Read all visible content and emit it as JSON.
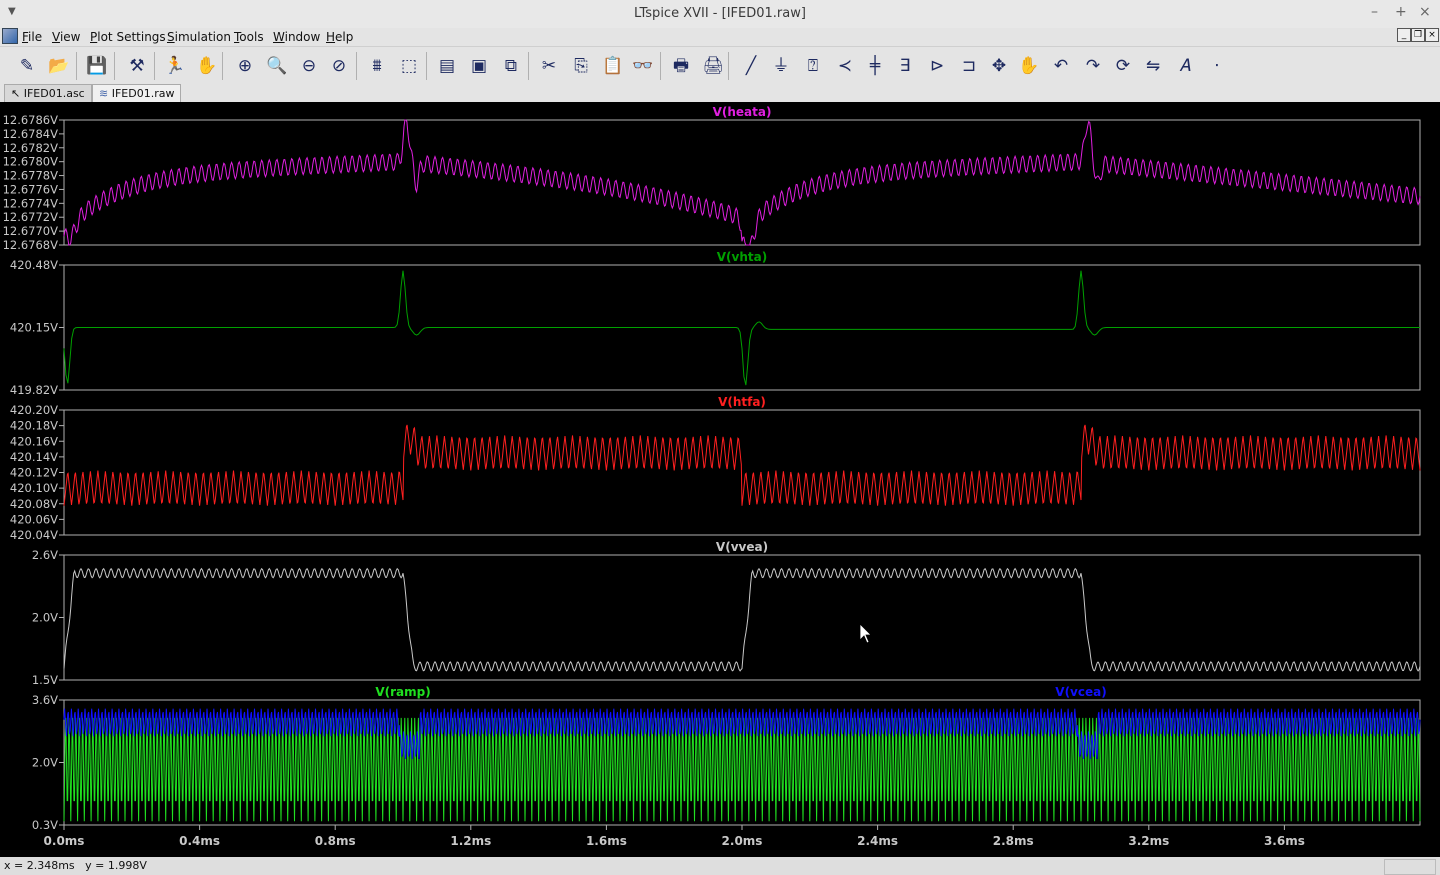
{
  "window": {
    "title": "LTspice XVII - [IFED01.raw]",
    "controls": [
      "–",
      "+",
      "×"
    ]
  },
  "menu": [
    "File",
    "View",
    "Plot Settings",
    "Simulation",
    "Tools",
    "Window",
    "Help"
  ],
  "toolbar_icons": [
    "new-schematic-icon",
    "open-icon",
    "save-icon",
    "control-panel-icon",
    "run-icon",
    "halt-icon",
    "zoom-in-icon",
    "zoom-out-icon",
    "zoom-full-icon",
    "zoom-cancel-icon",
    "autorange-icon",
    "select-plane-icon",
    "tile-horizontal-icon",
    "cascade-icon",
    "tile-vertical-icon",
    "cut-icon",
    "copy-icon",
    "paste-icon",
    "find-icon",
    "print-preview-icon",
    "print-icon",
    "draw-wire-icon",
    "ground-icon",
    "label-net-icon",
    "resistor-icon",
    "capacitor-icon",
    "inductor-icon",
    "diode-icon",
    "component-icon",
    "move-icon",
    "drag-icon",
    "undo-icon",
    "redo-icon",
    "rotate-icon",
    "mirror-icon",
    "text-icon",
    "spice-directive-icon"
  ],
  "tabs": [
    {
      "label": "IFED01.asc",
      "active": false
    },
    {
      "label": "IFED01.raw",
      "active": true
    }
  ],
  "status": {
    "x": "x = 2.348ms",
    "y": "y = 1.998V"
  },
  "colors": {
    "heata": "#e020e0",
    "vhta": "#00a000",
    "htfa": "#ff2020",
    "vvea": "#c8c8c8",
    "ramp": "#20e020",
    "vcea": "#1010ff"
  },
  "chart_data": [
    {
      "type": "line",
      "title": "V(heata)",
      "series": [
        {
          "name": "V(heata)",
          "color": "#e020e0"
        }
      ],
      "xlim": [
        0,
        4.0
      ],
      "ylim": [
        12.6768,
        12.6786
      ],
      "yticks": [
        "12.6786V",
        "12.6784V",
        "12.6782V",
        "12.6780V",
        "12.6778V",
        "12.6776V",
        "12.6774V",
        "12.6772V",
        "12.6770V",
        "12.6768V"
      ],
      "xticks": []
    },
    {
      "type": "line",
      "title": "V(vhta)",
      "series": [
        {
          "name": "V(vhta)",
          "color": "#00a000"
        }
      ],
      "xlim": [
        0,
        4.0
      ],
      "ylim": [
        419.82,
        420.48
      ],
      "yticks": [
        "420.48V",
        "420.15V",
        "419.82V"
      ],
      "xticks": []
    },
    {
      "type": "line",
      "title": "V(htfa)",
      "series": [
        {
          "name": "V(htfa)",
          "color": "#ff2020"
        }
      ],
      "xlim": [
        0,
        4.0
      ],
      "ylim": [
        420.04,
        420.2
      ],
      "yticks": [
        "420.20V",
        "420.18V",
        "420.16V",
        "420.14V",
        "420.12V",
        "420.10V",
        "420.08V",
        "420.06V",
        "420.04V"
      ],
      "xticks": []
    },
    {
      "type": "line",
      "title": "V(vvea)",
      "series": [
        {
          "name": "V(vvea)",
          "color": "#c8c8c8"
        }
      ],
      "xlim": [
        0,
        4.0
      ],
      "ylim": [
        1.5,
        2.6
      ],
      "yticks": [
        "2.6V",
        "2.0V",
        "1.5V"
      ],
      "xticks": []
    },
    {
      "type": "line",
      "title": "",
      "series": [
        {
          "name": "V(ramp)",
          "color": "#20e020"
        },
        {
          "name": "V(vcea)",
          "color": "#1010ff"
        }
      ],
      "xlim": [
        0,
        4.0
      ],
      "ylim": [
        0.3,
        3.6
      ],
      "yticks": [
        "3.6V",
        "2.0V",
        "0.3V"
      ],
      "xticks": [
        "0.0ms",
        "0.4ms",
        "0.8ms",
        "1.2ms",
        "1.6ms",
        "2.0ms",
        "2.4ms",
        "2.8ms",
        "3.2ms",
        "3.6ms"
      ]
    }
  ]
}
